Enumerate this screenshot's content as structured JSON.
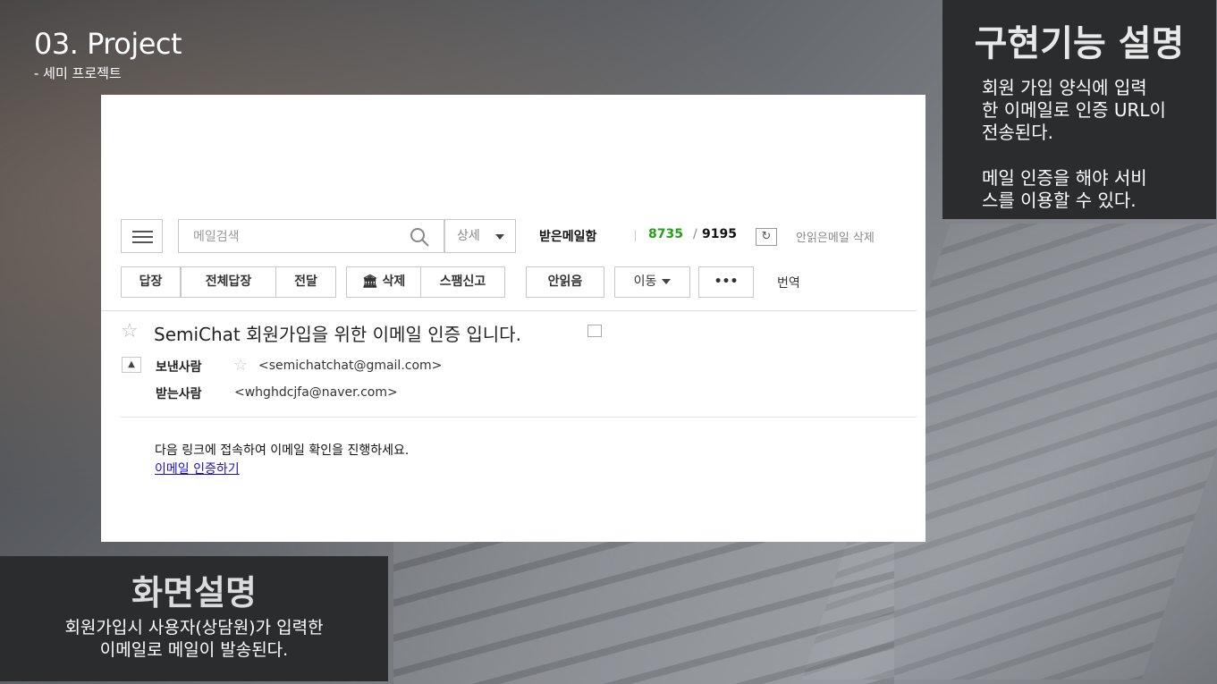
{
  "slide": {
    "title": "03. Project",
    "subtitle": "- 세미 프로젝트"
  },
  "feature_panel": {
    "heading": "구현기능 설명",
    "text1_line1": "회원 가입 양식에 입력",
    "text1_line2": "한 이메일로 인증 URL이",
    "text1_line3": "전송된다.",
    "text2_line1": "메일 인증을 해야 서비",
    "text2_line2": "스를 이용할 수 있다."
  },
  "screen_panel": {
    "heading": "화면설명",
    "line1": "회원가입시 사용자(상담원)가 입력한",
    "line2": "이메일로 메일이 발송된다."
  },
  "mail": {
    "search_placeholder": "메일검색",
    "detail_label": "상세",
    "inbox_label": "받은메일함",
    "unread_count": "8735",
    "slash": "/",
    "total_count": "9195",
    "refresh_icon": "refresh-icon",
    "delete_unread": "안읽은메일 삭제",
    "buttons": {
      "reply": "답장",
      "reply_all": "전체답장",
      "forward": "전달",
      "delete": "삭제",
      "spam": "스팸신고",
      "unread": "안읽음",
      "move": "이동",
      "more": "•••",
      "translate": "번역"
    },
    "subject": "SemiChat 회원가입을 위한 이메일 인증 입니다.",
    "from_label": "보낸사람",
    "from_address": "<semichatchat@gmail.com>",
    "to_label": "받는사람",
    "to_address": "<whghdcjfa@naver.com>",
    "body_text": "다음 링크에 접속하여 이메일 확인을 진행하세요.",
    "verify_link": "이메일 인증하기"
  },
  "colors": {
    "unread_count": "#22a316",
    "panel_bg": "#2b2c2e",
    "link": "#1a0dcc"
  }
}
